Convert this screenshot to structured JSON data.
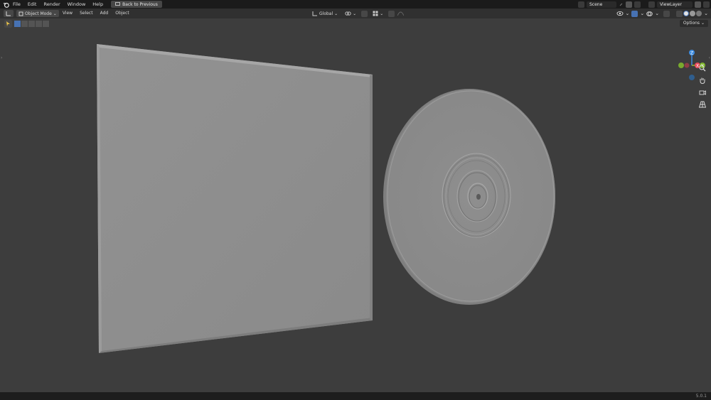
{
  "topbar": {
    "menus": [
      "File",
      "Edit",
      "Render",
      "Window",
      "Help"
    ],
    "back_button": "Back to Previous",
    "scene": "Scene",
    "view_layer": "ViewLayer"
  },
  "header": {
    "mode": "Object Mode",
    "menus": [
      "View",
      "Select",
      "Add",
      "Object"
    ],
    "transform_orientation": "Global"
  },
  "tool_header": {
    "options": "Options"
  },
  "gizmo": {
    "z": "Z",
    "x": "X",
    "y": "Y"
  },
  "colors": {
    "accent": "#4772b3",
    "axis_x": "#e84b5b",
    "axis_y": "#7fb62c",
    "axis_z": "#3d8ce0",
    "object": "#8f8f8f"
  },
  "status": {
    "version": "5.0.1"
  }
}
